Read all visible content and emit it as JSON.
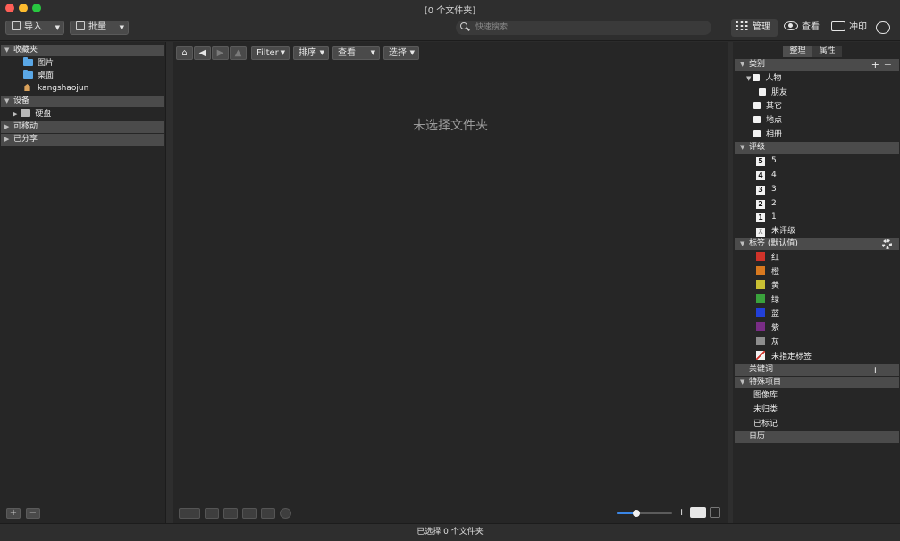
{
  "window": {
    "title": "[0 个文件夹]"
  },
  "toolbar": {
    "import_label": "导入",
    "batch_label": "批量",
    "search_placeholder": "快速搜索",
    "modes": [
      {
        "label": "管理",
        "icon": "grid-icon",
        "active": true
      },
      {
        "label": "查看",
        "icon": "eye-icon",
        "active": false
      },
      {
        "label": "冲印",
        "icon": "print-icon",
        "active": false
      }
    ]
  },
  "sidebar": {
    "favorites_label": "收藏夹",
    "favorites": [
      {
        "label": "图片",
        "icon": "folder-icon"
      },
      {
        "label": "桌面",
        "icon": "folder-icon"
      },
      {
        "label": "kangshaojun",
        "icon": "home-icon"
      }
    ],
    "devices_label": "设备",
    "devices": [
      {
        "label": "硬盘",
        "icon": "disk-icon"
      }
    ],
    "removable_label": "可移动",
    "shared_label": "已分享",
    "add_label": "+",
    "remove_label": "−"
  },
  "browser": {
    "filter_label": "Filter",
    "sort_label": "排序",
    "view_label": "查看",
    "select_label": "选择",
    "empty_message": "未选择文件夹",
    "zoom_minus": "−",
    "zoom_plus": "+",
    "zoom_level": 0.35
  },
  "organizer": {
    "tabs": [
      "整理",
      "属性"
    ],
    "categories_label": "类别",
    "categories": [
      {
        "label": "人物",
        "indent": 1
      },
      {
        "label": "朋友",
        "indent": 2
      },
      {
        "label": "其它",
        "indent": 1
      },
      {
        "label": "地点",
        "indent": 1
      },
      {
        "label": "相册",
        "indent": 1
      }
    ],
    "rating_label": "评级",
    "ratings": [
      {
        "badge": "5",
        "label": "5"
      },
      {
        "badge": "4",
        "label": "4"
      },
      {
        "badge": "3",
        "label": "3"
      },
      {
        "badge": "2",
        "label": "2"
      },
      {
        "badge": "1",
        "label": "1"
      },
      {
        "badge": "X",
        "label": "未评级"
      }
    ],
    "labels_label": "标签 (默认值)",
    "color_labels": [
      {
        "label": "红",
        "color": "#d0332a"
      },
      {
        "label": "橙",
        "color": "#d8791f"
      },
      {
        "label": "黄",
        "color": "#c9c033"
      },
      {
        "label": "绿",
        "color": "#3aa33c"
      },
      {
        "label": "蓝",
        "color": "#2240d8"
      },
      {
        "label": "紫",
        "color": "#7a2d86"
      },
      {
        "label": "灰",
        "color": "#8d8d8d"
      },
      {
        "label": "未指定标签",
        "color": "none"
      }
    ],
    "keywords_label": "关键词",
    "special_label": "特殊项目",
    "special_items": [
      "图像库",
      "未归类",
      "已标记"
    ],
    "calendar_label": "日历"
  },
  "status": {
    "text": "已选择 0 个文件夹"
  }
}
